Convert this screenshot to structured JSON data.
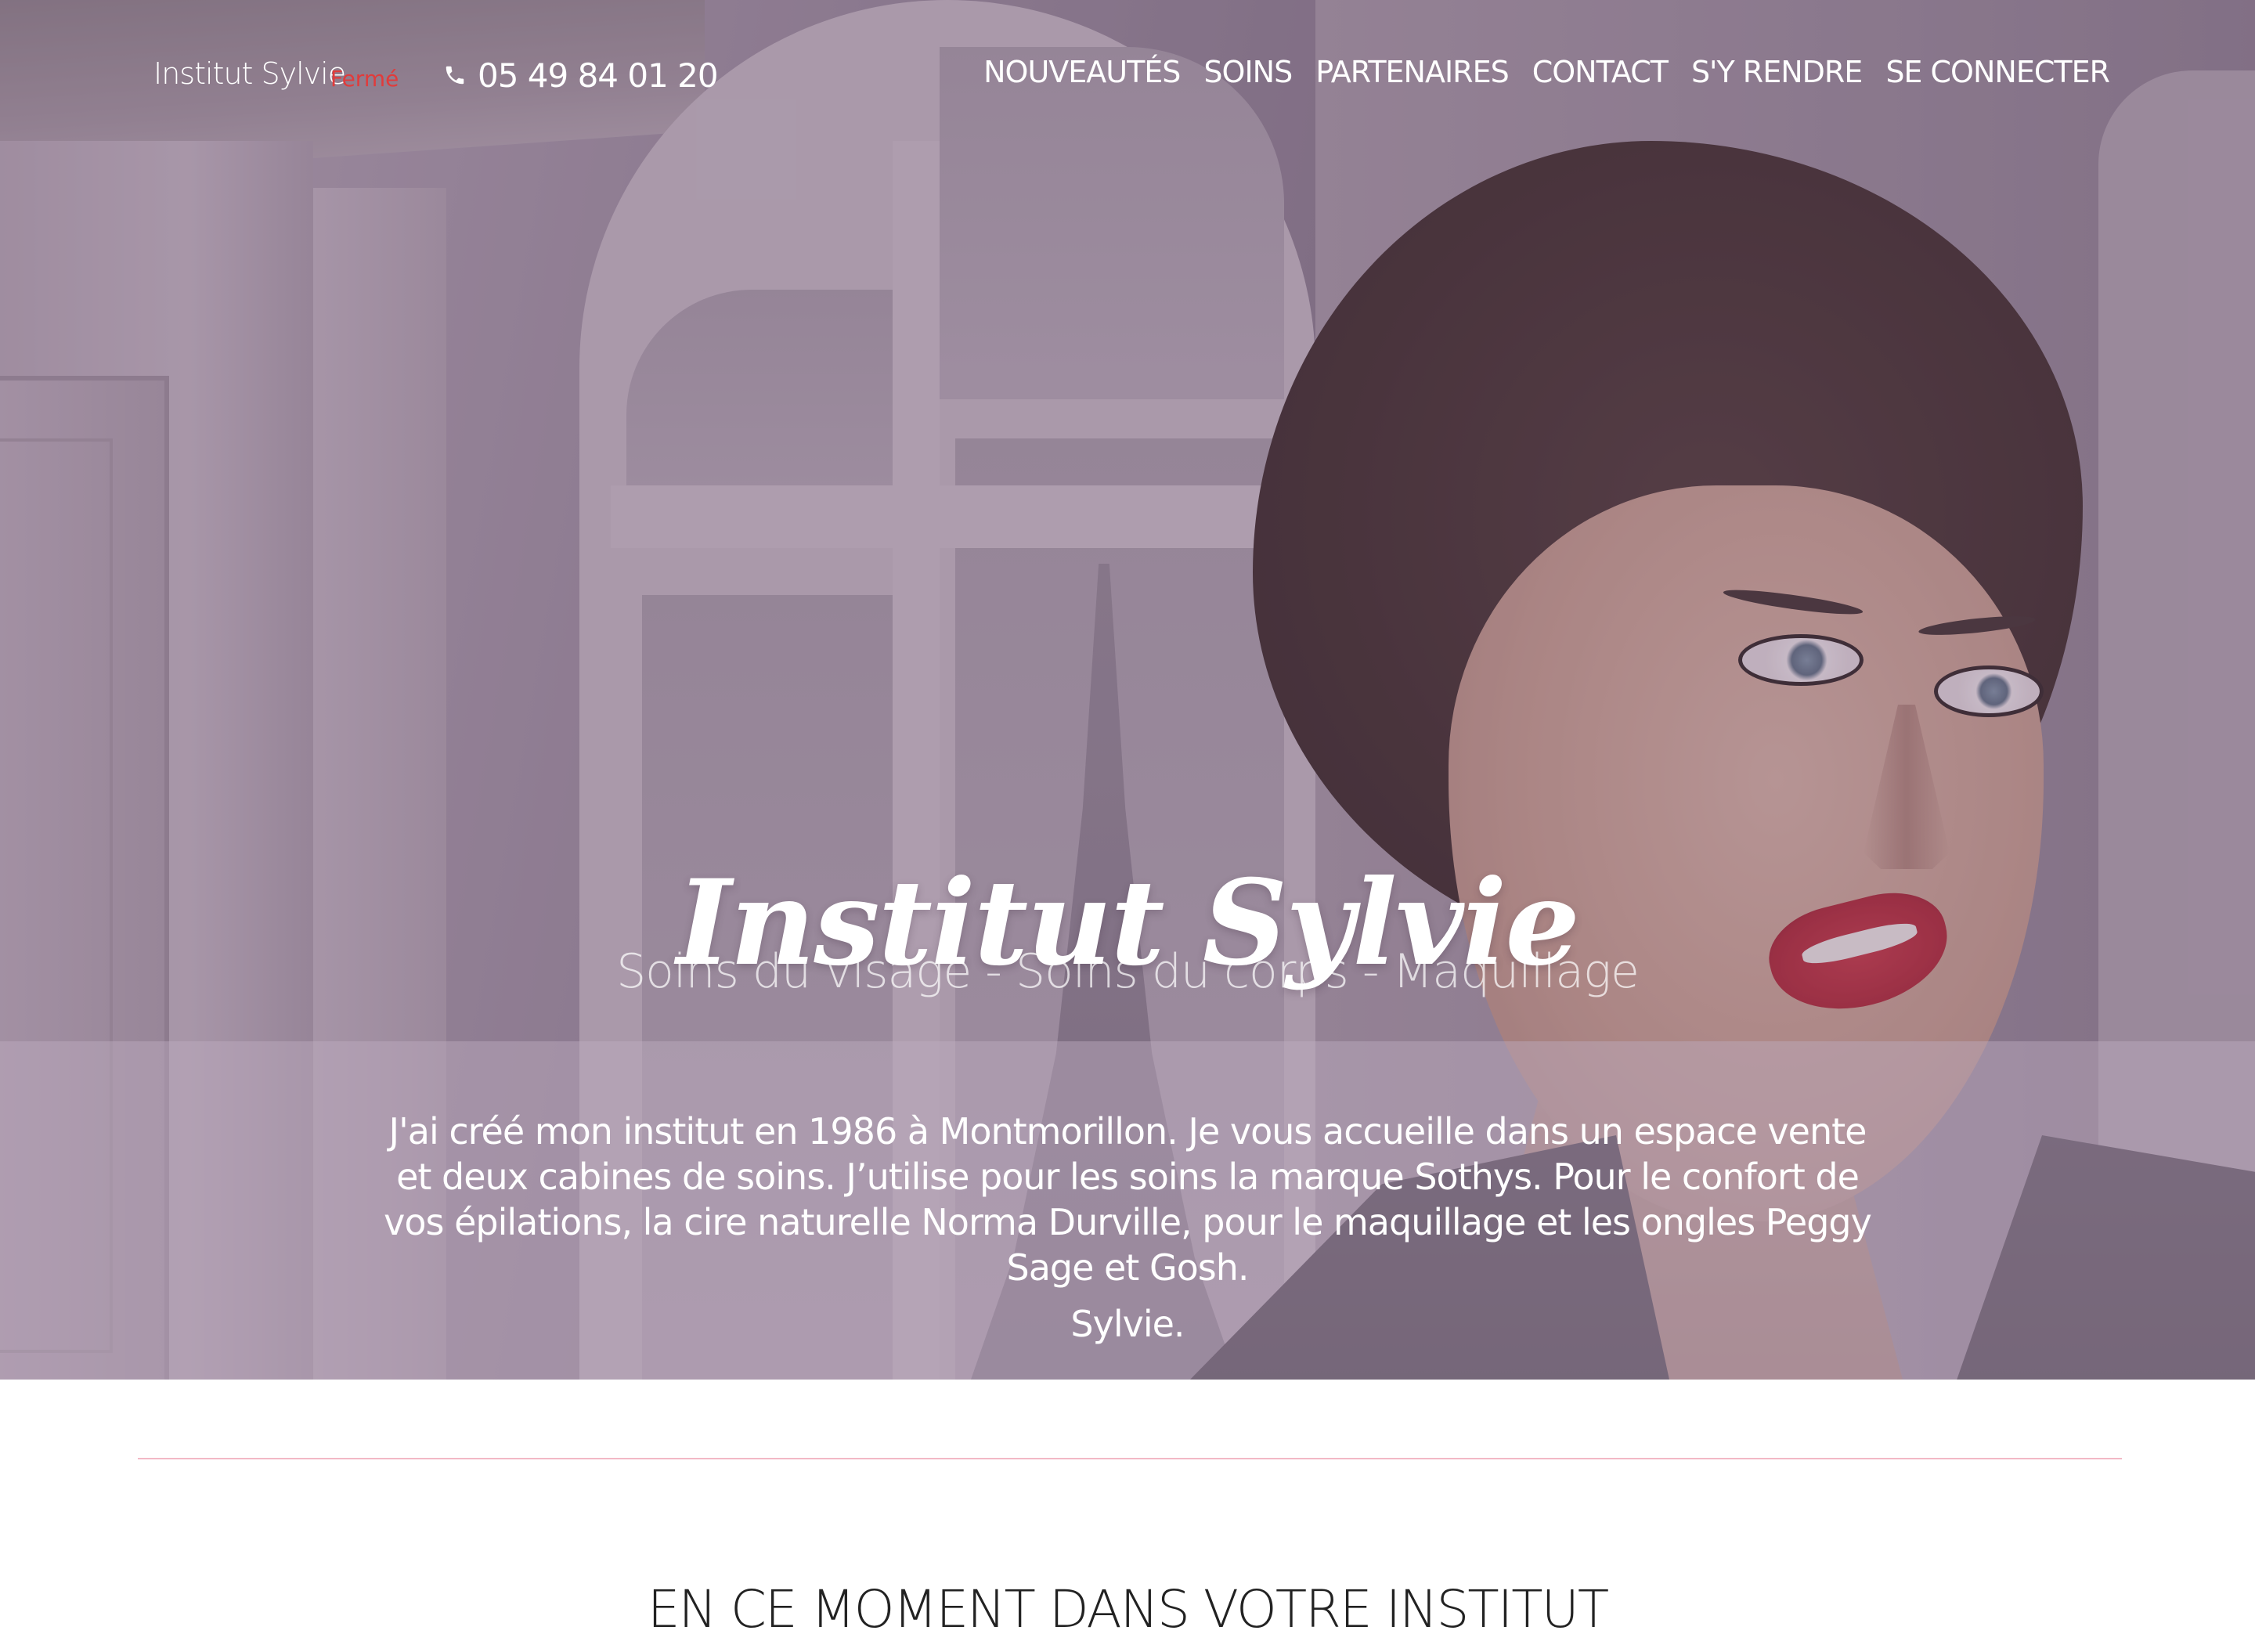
{
  "header": {
    "brand": "Institut Sylvie",
    "status": "Fermé",
    "phone_icon": "phone-icon",
    "phone": "05 49 84 01 20",
    "nav": [
      {
        "label": "NOUVEAUTÉS"
      },
      {
        "label": "SOINS"
      },
      {
        "label": "PARTENAIRES"
      },
      {
        "label": "CONTACT"
      },
      {
        "label": "S'Y RENDRE"
      },
      {
        "label": "SE CONNECTER"
      }
    ]
  },
  "hero": {
    "title": "Institut Sylvie",
    "subtitle": "Soins du visage - Soins du corps - Maquillage",
    "intro": "J'ai créé mon institut en 1986 à Montmorillon. Je vous accueille dans un espace vente et deux cabines de soins. J’utilise pour les soins la marque Sothys. Pour le confort de vos épilations, la cire naturelle Norma Durville, pour le maquillage et les ongles Peggy Sage et Gosh.",
    "signature": "Sylvie."
  },
  "section": {
    "title": "EN CE MOMENT DANS VOTRE INSTITUT"
  },
  "colors": {
    "status": "#e13b3b",
    "divider": "#f2b8c6",
    "overlay": "#8f7b92"
  }
}
